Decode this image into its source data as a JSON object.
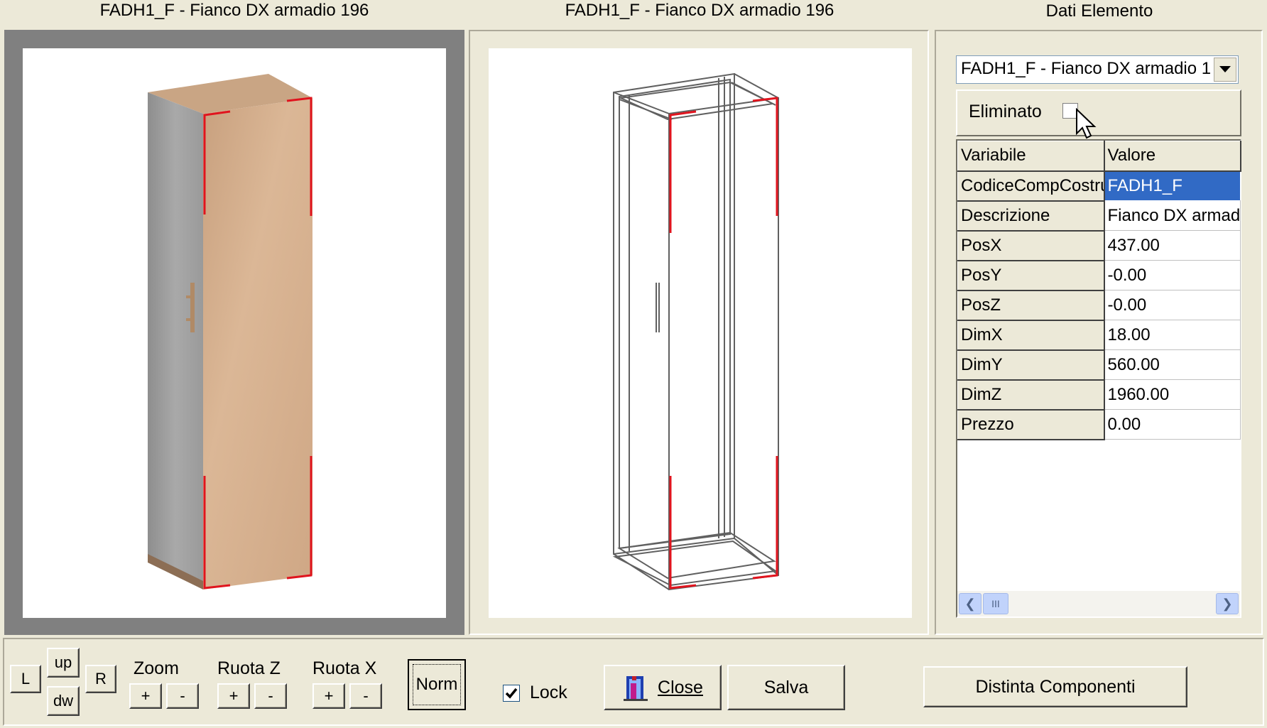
{
  "panels": {
    "left_title": "FADH1_F - Fianco DX armadio 196",
    "middle_title": "FADH1_F - Fianco DX armadio 196",
    "right_title": "Dati Elemento"
  },
  "element_data": {
    "selector_value": "FADH1_F - Fianco DX armadio 1",
    "deleted_label": "Eliminato",
    "deleted_checked": false,
    "grid": {
      "headers": [
        "Variabile",
        "Valore"
      ],
      "rows": [
        {
          "variable": "CodiceCompCostru",
          "value": "FADH1_F"
        },
        {
          "variable": "Descrizione",
          "value": "Fianco DX armad"
        },
        {
          "variable": "PosX",
          "value": "437.00"
        },
        {
          "variable": "PosY",
          "value": "-0.00"
        },
        {
          "variable": "PosZ",
          "value": "-0.00"
        },
        {
          "variable": "DimX",
          "value": "18.00"
        },
        {
          "variable": "DimY",
          "value": "560.00"
        },
        {
          "variable": "DimZ",
          "value": "1960.00"
        },
        {
          "variable": "Prezzo",
          "value": "0.00"
        }
      ],
      "scroll_thumb": "III"
    }
  },
  "toolbar": {
    "left_button": "L",
    "up_button": "up",
    "down_button": "dw",
    "right_button": "R",
    "zoom_label": "Zoom",
    "rotate_z_label": "Ruota Z",
    "rotate_x_label": "Ruota X",
    "plus": "+",
    "minus": "-",
    "norm_button": "Norm",
    "lock_label": "Lock",
    "lock_checked": true,
    "close_button": "Close",
    "save_button": "Salva",
    "components_button": "Distinta Componenti"
  },
  "colors": {
    "window_bg": "#ece9d8",
    "viewport_bg": "#ffffff",
    "highlight_edge": "#e0141e",
    "wood": "#d7b08c",
    "selection": "#316ac5"
  }
}
